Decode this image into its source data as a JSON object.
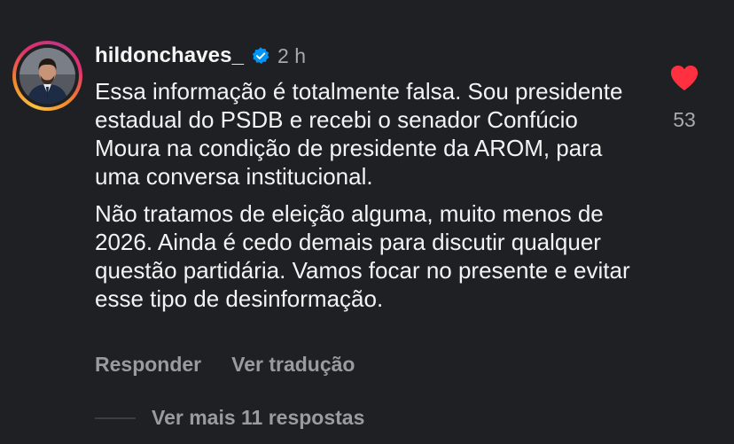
{
  "comment": {
    "username": "hildonchaves_",
    "verified": true,
    "time_ago": "2 h",
    "paragraphs": [
      "Essa informação é totalmente falsa. Sou presidente estadual do PSDB e recebi o senador Confúcio Moura na condição de presidente da AROM, para uma conversa institucional.",
      "Não tratamos de eleição alguma, muito menos de 2026. Ainda é cedo demais para discutir qualquer questão partidária. Vamos focar no presente e evitar esse tipo de desinformação."
    ],
    "like_count": "53",
    "liked": true,
    "actions": {
      "reply_label": "Responder",
      "translate_label": "Ver tradução"
    },
    "view_replies_label": "Ver mais 11 respostas"
  },
  "icons": {
    "avatar": "avatar",
    "verified": "verified-badge-icon",
    "like": "heart-icon"
  },
  "colors": {
    "background": "#1f2024",
    "heart": "#ff3040",
    "verified": "#0095f6",
    "muted_text": "#9a9aa0"
  }
}
